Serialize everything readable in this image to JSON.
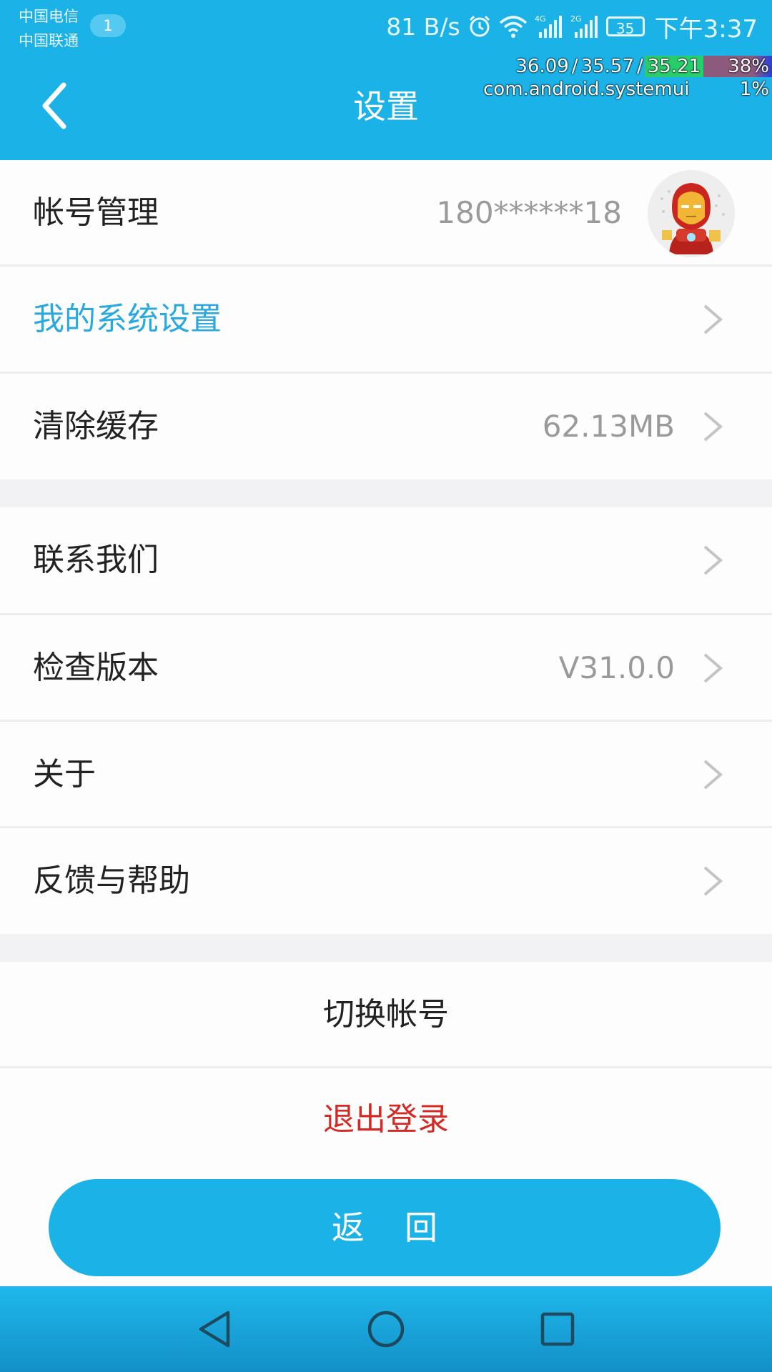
{
  "status_bar": {
    "carrier_1": "中国电信",
    "carrier_2": "中国联通",
    "sim_badge": "1",
    "net_speed": "81 B/s",
    "network_1": "4G",
    "network_2": "2G",
    "battery": "35",
    "time": "下午3:37",
    "icons": [
      "alarm-icon",
      "wifi-icon",
      "signal-4g-icon",
      "signal-2g-icon",
      "battery-icon"
    ]
  },
  "perf_overlay": {
    "load_1": "36.09",
    "load_2": "35.57",
    "load_3": "35.21",
    "total_cpu": "38%",
    "process": "com.android.systemui",
    "process_cpu": "1%"
  },
  "header": {
    "title": "设置"
  },
  "settings": {
    "account": {
      "label": "帐号管理",
      "value": "180******18"
    },
    "system": {
      "label": "我的系统设置"
    },
    "cache": {
      "label": "清除缓存",
      "value": "62.13MB"
    },
    "contact": {
      "label": "联系我们"
    },
    "version": {
      "label": "检查版本",
      "value": "V31.0.0"
    },
    "about": {
      "label": "关于"
    },
    "feedback": {
      "label": "反馈与帮助"
    }
  },
  "actions": {
    "switch_account": "切换帐号",
    "logout": "退出登录",
    "return": "返回"
  },
  "colors": {
    "brand": "#1bb2e8",
    "accent_text": "#29a9de",
    "danger": "#d42a25",
    "background": "#f2f2f4"
  }
}
